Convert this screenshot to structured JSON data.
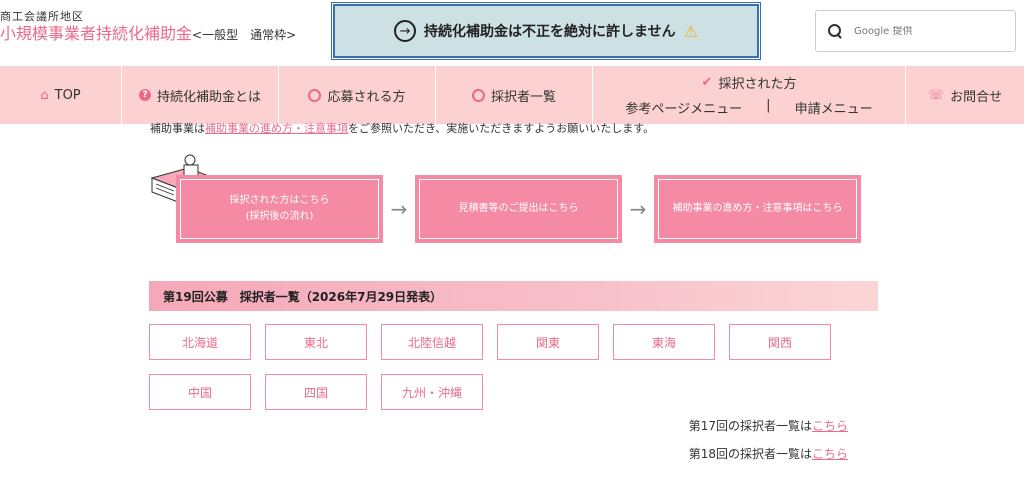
{
  "header": {
    "brand_sub": "商工会議所地区",
    "brand_main_a": "小規模事業者",
    "brand_main_b": "持続化補助金",
    "brand_main_c": "<一般型　通常枠>",
    "notice_text": "持続化補助金は不正を絶対に許しません",
    "search_placeholder": "Google 提供"
  },
  "nav": {
    "top": "TOP",
    "about": "持続化補助金とは",
    "applicants": "応募される方",
    "adopted_list": "採択者一覧",
    "adopted": "採択された方",
    "ref_menu": "参考ページメニュー",
    "divider": "|",
    "apply_menu": "申請メニュー",
    "contact": "お問合せ"
  },
  "content": {
    "intro_pre": "補助事業は",
    "intro_link": "補助事業の進め方・注意事項",
    "intro_post": "をご参照いただき、実施いただきますようお願いいたします。",
    "flow": [
      {
        "line1": "採択された方はこちら",
        "line2": "(採択後の流れ)"
      },
      {
        "line1": "見積書等のご提出はこちら",
        "line2": ""
      },
      {
        "line1": "補助事業の進め方・注意事項はこちら",
        "line2": ""
      }
    ],
    "section_title": "第19回公募　採択者一覧（2026年7月29日発表）",
    "regions": [
      "北海道",
      "東北",
      "北陸信越",
      "関東",
      "東海",
      "関西",
      "中国",
      "四国",
      "九州・沖縄"
    ],
    "past17_text": "第17回の採択者一覧は",
    "past18_text": "第18回の採択者一覧は",
    "link_label": "こちら"
  },
  "colors": {
    "accent": "#e96a8a",
    "nav_bg": "#fbd1d1",
    "button_bg": "#f48aa3",
    "notice_bg": "#cde0e4"
  }
}
